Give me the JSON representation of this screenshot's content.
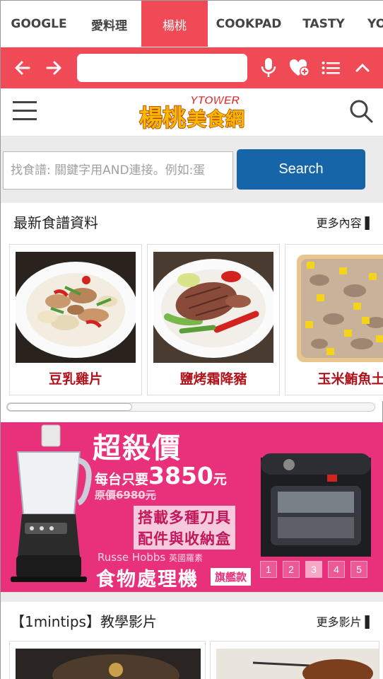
{
  "tabs": [
    {
      "label": "GOOGLE",
      "active": false
    },
    {
      "label": "愛料理",
      "active": false
    },
    {
      "label": "楊桃",
      "active": true
    },
    {
      "label": "COOKPAD",
      "active": false
    },
    {
      "label": "TASTY",
      "active": false
    },
    {
      "label": "YO",
      "active": false
    }
  ],
  "toolbar": {
    "url_value": "",
    "icons": [
      "back-arrow-icon",
      "forward-arrow-icon",
      "microphone-icon",
      "heart-plus-icon",
      "list-icon",
      "chevron-up-icon"
    ]
  },
  "site": {
    "logo_cn": "楊桃美食網",
    "logo_en": "YTOWER"
  },
  "search": {
    "placeholder": "找食譜: 關鍵字用AND連接。例如:蛋",
    "button_label": "Search"
  },
  "recipes_section": {
    "title": "最新食譜資料",
    "more": "更多內容"
  },
  "recipes": [
    {
      "name": "豆乳雞片"
    },
    {
      "name": "鹽烤霜降豬"
    },
    {
      "name": "玉米鮪魚土"
    }
  ],
  "scrollbar": {
    "thumb_fraction": 0.34
  },
  "banner": {
    "title": "超殺價",
    "price_prefix": "每台只要",
    "price": "3850",
    "price_suffix": "元",
    "original_price": "原價6980元",
    "feature_1": "搭載多種刀具",
    "feature_2": "配件與收納盒",
    "brand": "Russe Hobbs",
    "brand_cn": "英國羅素",
    "product": "食物處理機",
    "flagship": "旗艦款",
    "pages": [
      "1",
      "2",
      "3",
      "4",
      "5"
    ],
    "active_page": "3",
    "colors": {
      "background": "#e9307a",
      "feature_bg": "#f7c9de"
    }
  },
  "tips_section": {
    "title": "【1mintips】教學影片",
    "more": "更多影片"
  },
  "colors": {
    "accent_red": "#f04a56",
    "search_blue": "#1565a8",
    "recipe_name": "#b0141d"
  }
}
